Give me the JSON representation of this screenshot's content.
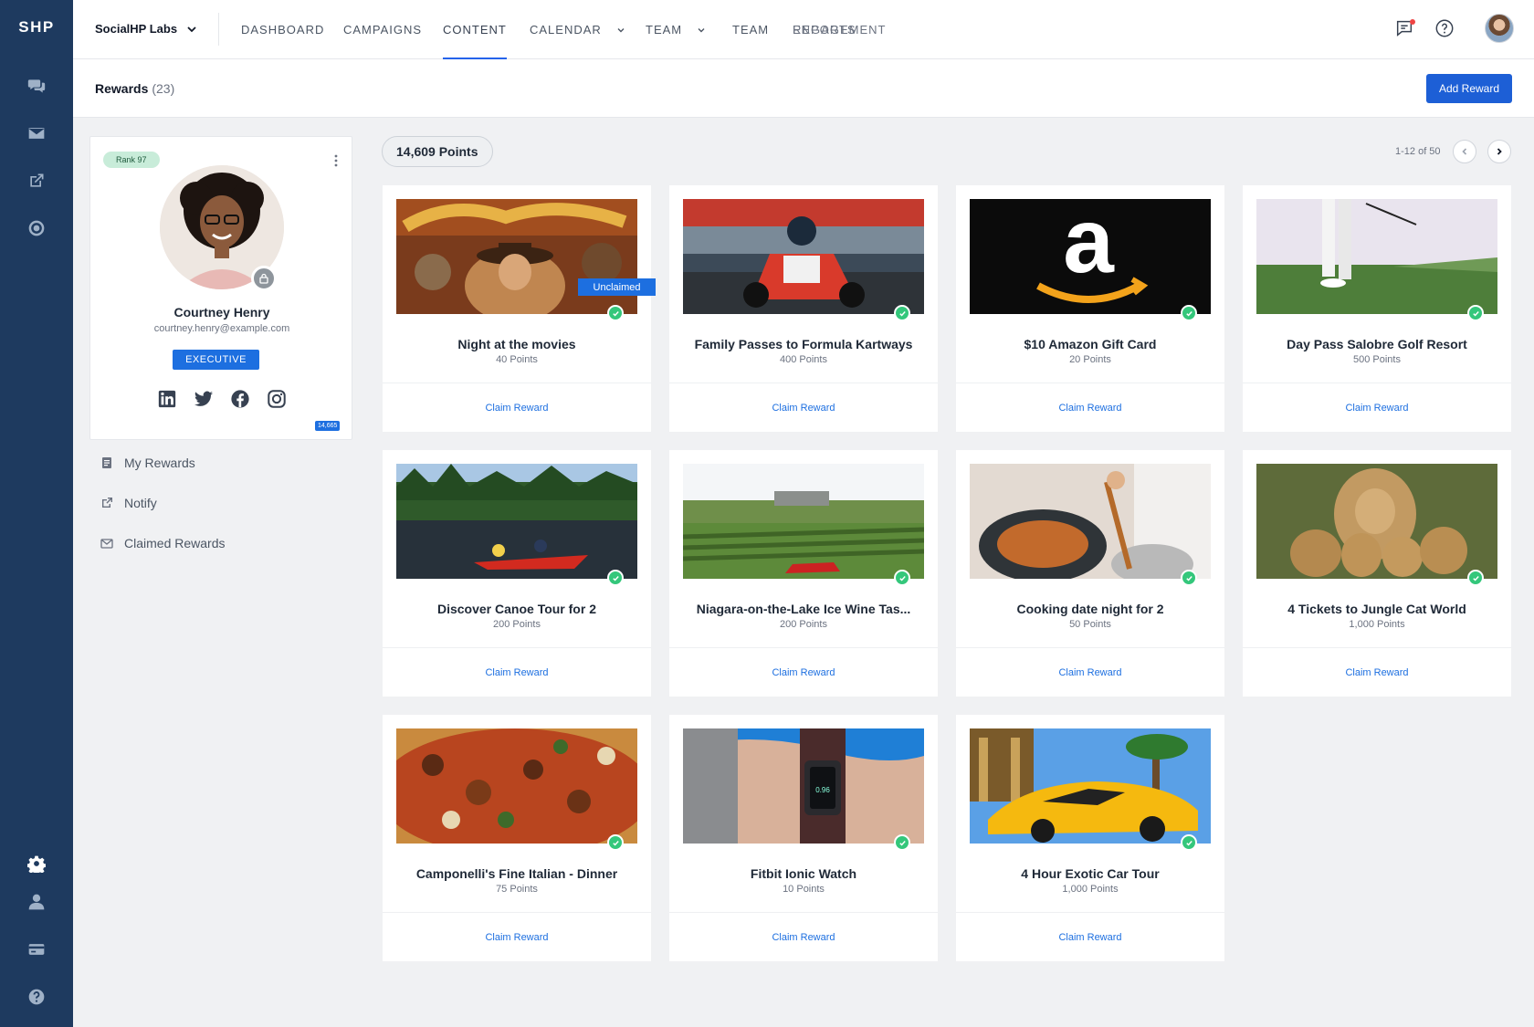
{
  "app": {
    "logo": "SHP",
    "org": "SocialHP Labs"
  },
  "nav": {
    "items": [
      {
        "label": "DASHBOARD"
      },
      {
        "label": "CAMPAIGNS"
      },
      {
        "label": "CONTENT",
        "active": true
      },
      {
        "label": "CALENDAR",
        "has_chevron": true
      },
      {
        "label": "TEAM",
        "has_chevron": true
      },
      {
        "label": "TEAM"
      }
    ],
    "overlap_a": "REPORTS",
    "overlap_b": "ENGAGEMENT"
  },
  "page": {
    "title": "Rewards",
    "count": "(23)",
    "add_button": "Add Reward"
  },
  "profile": {
    "rank": "Rank 97",
    "name": "Courtney Henry",
    "email": "courtney.henry@example.com",
    "tag": "EXECUTIVE",
    "points_badge": "14,665",
    "social": [
      "linkedin-icon",
      "twitter-icon",
      "facebook-icon",
      "instagram-icon"
    ]
  },
  "sidebar": {
    "items": [
      {
        "label": "My Rewards",
        "icon": "list-icon"
      },
      {
        "label": "Notify",
        "icon": "external-link-icon"
      },
      {
        "label": "Claimed Rewards",
        "icon": "envelope-icon"
      }
    ]
  },
  "points": {
    "label": "14,609 Points"
  },
  "pagination": {
    "text": "1-12 of 50"
  },
  "cards": [
    {
      "title": "Night at the movies",
      "points": "40 Points",
      "claim": "Claim Reward",
      "badge": "Unclaimed",
      "image": "movie-poster"
    },
    {
      "title": "Family Passes to Formula Kartways",
      "points": "400 Points",
      "claim": "Claim Reward",
      "image": "go-kart"
    },
    {
      "title": "$10 Amazon Gift Card",
      "points": "20 Points",
      "claim": "Claim Reward",
      "image": "amazon-logo"
    },
    {
      "title": "Day Pass Salobre Golf Resort",
      "points": "500 Points",
      "claim": "Claim Reward",
      "image": "golf"
    },
    {
      "title": "Discover Canoe Tour for 2",
      "points": "200 Points",
      "claim": "Claim Reward",
      "image": "canoe"
    },
    {
      "title": "Niagara-on-the-Lake Ice Wine Tas...",
      "points": "200 Points",
      "claim": "Claim Reward",
      "image": "vineyard"
    },
    {
      "title": "Cooking date night for 2",
      "points": "50 Points",
      "claim": "Claim Reward",
      "image": "cooking"
    },
    {
      "title": "4 Tickets to Jungle Cat World",
      "points": "1,000 Points",
      "claim": "Claim Reward",
      "image": "lions"
    },
    {
      "title": "Camponelli's Fine Italian - Dinner",
      "points": "75 Points",
      "claim": "Claim Reward",
      "image": "pizza"
    },
    {
      "title": "Fitbit Ionic Watch",
      "points": "10 Points",
      "claim": "Claim Reward",
      "image": "watch"
    },
    {
      "title": "4 Hour Exotic Car Tour",
      "points": "1,000 Points",
      "claim": "Claim Reward",
      "image": "sports-car"
    }
  ],
  "colors": {
    "rail": "#1e3a5f",
    "accent": "#1d6fe0",
    "success": "#34c77b",
    "rank_bg": "#c8ecd9"
  }
}
